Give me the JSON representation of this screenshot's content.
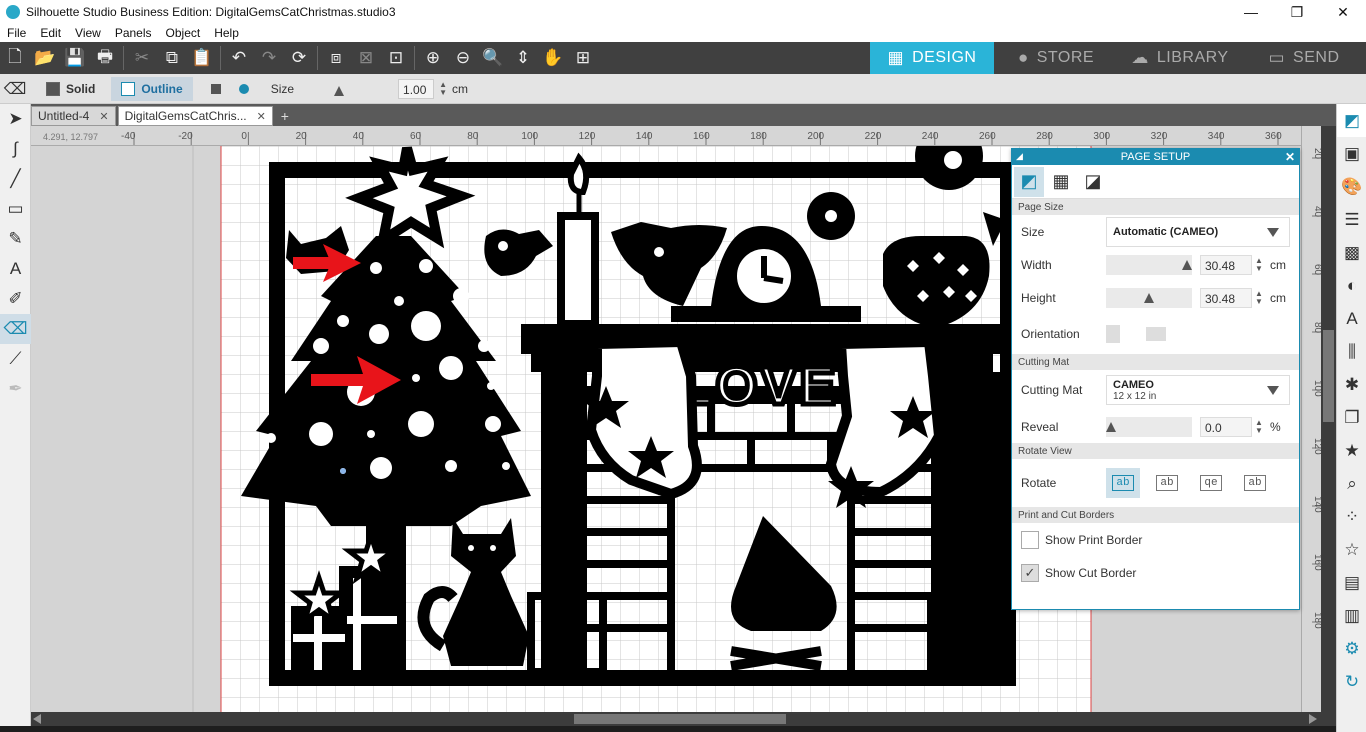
{
  "window": {
    "title": "Silhouette Studio Business Edition: DigitalGemsCatChristmas.studio3",
    "controls": {
      "minimize": "—",
      "maximize": "❐",
      "close": "✕"
    }
  },
  "menu": [
    "File",
    "Edit",
    "View",
    "Panels",
    "Object",
    "Help"
  ],
  "mode_tabs": [
    {
      "label": "DESIGN",
      "icon": "grid-icon",
      "active": true
    },
    {
      "label": "STORE",
      "icon": "store-s-icon",
      "active": false
    },
    {
      "label": "LIBRARY",
      "icon": "cloud-download-icon",
      "active": false
    },
    {
      "label": "SEND",
      "icon": "cutter-icon",
      "active": false
    }
  ],
  "options": {
    "solid_label": "Solid",
    "outline_label": "Outline",
    "size_label": "Size",
    "size_value": "1.00",
    "size_unit": "cm",
    "active_mode": "Outline"
  },
  "doc_tabs": [
    {
      "label": "Untitled-4",
      "active": false
    },
    {
      "label": "DigitalGemsCatChris...",
      "active": true
    }
  ],
  "doc_tabs_add": "+",
  "ruler": {
    "coords": "4.291, 12.797",
    "h_ticks": [
      "-40",
      "-20",
      "0",
      "20",
      "40",
      "60",
      "80",
      "100",
      "120",
      "140",
      "160",
      "180",
      "200",
      "220",
      "240",
      "260",
      "280",
      "300",
      "320",
      "340",
      "360"
    ],
    "v_ticks": [
      "20",
      "40",
      "60",
      "80",
      "100",
      "120",
      "140",
      "160",
      "180"
    ]
  },
  "canvas": {
    "text_love": "LOVE"
  },
  "page_setup": {
    "title": "PAGE SETUP",
    "collapse": "◢",
    "close": "✕",
    "sections": {
      "page_size": "Page Size",
      "cutting_mat": "Cutting Mat",
      "rotate_view": "Rotate View",
      "borders": "Print and Cut Borders"
    },
    "size_label": "Size",
    "size_value": "Automatic (CAMEO)",
    "width_label": "Width",
    "width_value": "30.48",
    "width_unit": "cm",
    "height_label": "Height",
    "height_value": "30.48",
    "height_unit": "cm",
    "orientation_label": "Orientation",
    "mat_label": "Cutting Mat",
    "mat_value": "CAMEO",
    "mat_sub": "12 x 12 in",
    "reveal_label": "Reveal",
    "reveal_value": "0.0",
    "reveal_unit": "%",
    "rotate_label": "Rotate",
    "rotate_options": [
      "ab",
      "ab",
      "qe",
      "ab"
    ],
    "show_print_border": {
      "label": "Show Print Border",
      "checked": false
    },
    "show_cut_border": {
      "label": "Show Cut Border",
      "checked": true
    }
  },
  "colors": {
    "accent": "#2ab4d8",
    "panel_header": "#1b8bb0",
    "toolbar": "#404040",
    "annotation_arrow": "#e8141a"
  }
}
